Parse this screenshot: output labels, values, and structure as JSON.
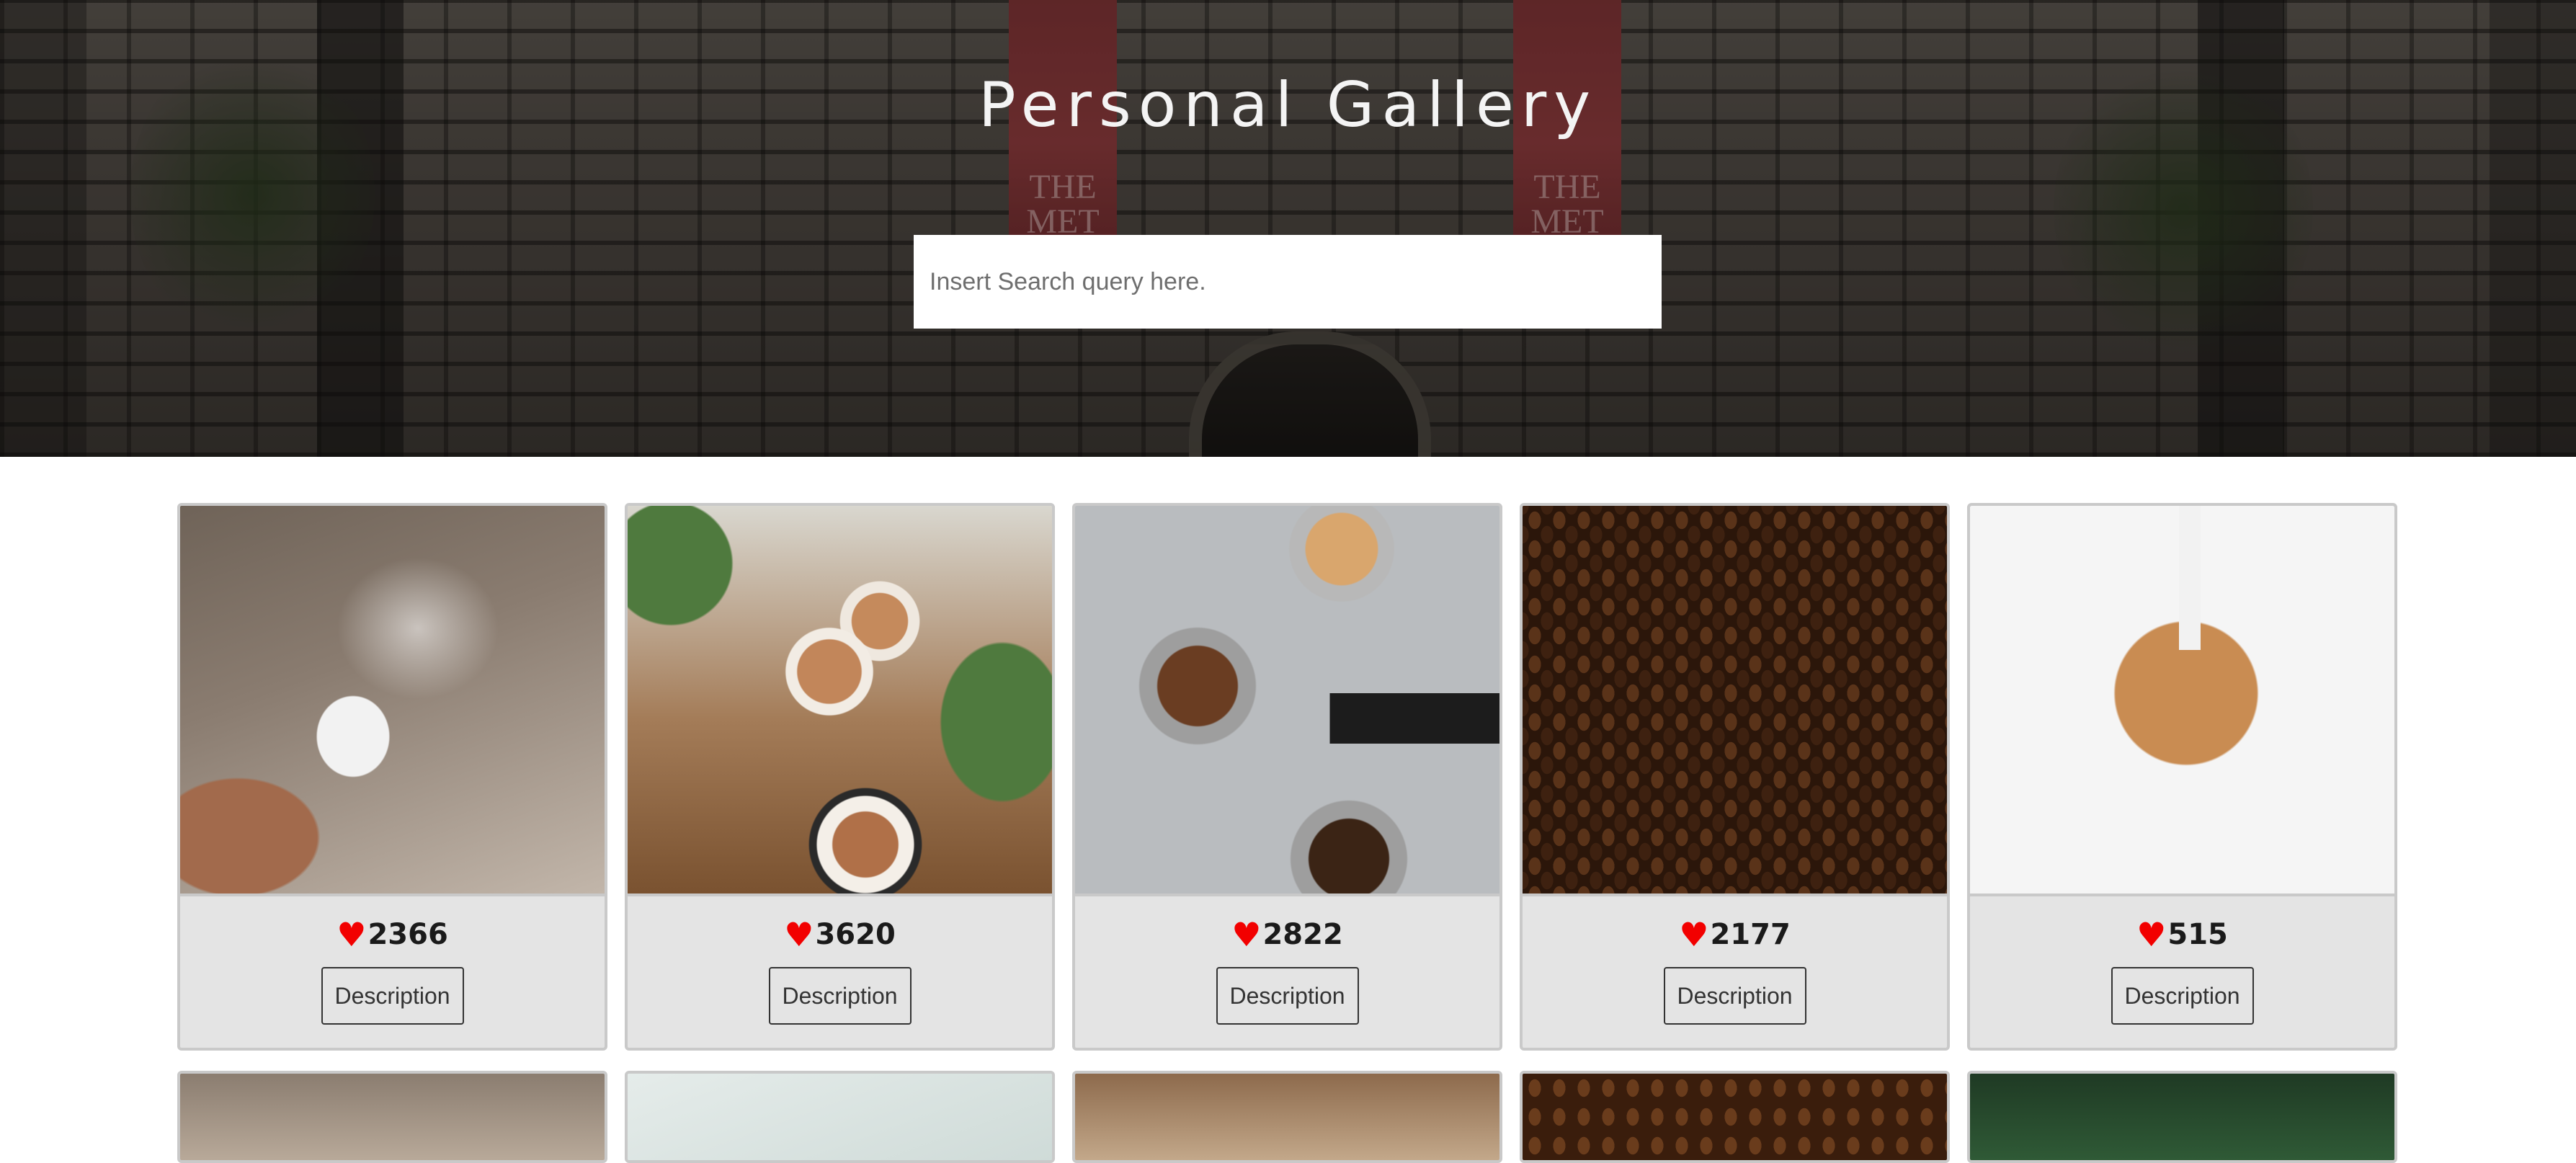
{
  "header": {
    "title": "Personal Gallery",
    "banner_text": "THE MET"
  },
  "search": {
    "placeholder": "Insert Search query here.",
    "value": ""
  },
  "gallery": {
    "button_label": "Description",
    "like_color": "#f20000",
    "cards": [
      {
        "image": "steaming-coffee-cup",
        "likes": "2366"
      },
      {
        "image": "latte-art-cups-with-plants",
        "likes": "3620"
      },
      {
        "image": "espresso-portafilters",
        "likes": "2822"
      },
      {
        "image": "coffee-beans",
        "likes": "2177"
      },
      {
        "image": "milk-pour-latte",
        "likes": "515"
      }
    ],
    "second_row_images": [
      "coffee-photo",
      "coffee-photo",
      "coffee-photo",
      "coffee-beans",
      "plant-photo"
    ]
  }
}
